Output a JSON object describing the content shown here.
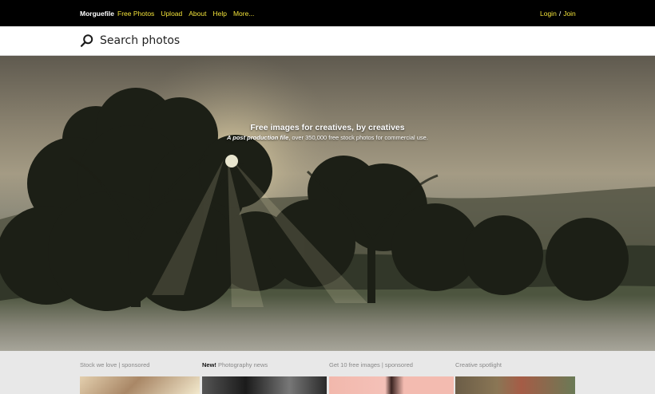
{
  "topbar": {
    "brand": "Morguefile",
    "nav": [
      "Free Photos",
      "Upload",
      "About",
      "Help",
      "More..."
    ],
    "login": "Login",
    "separator": "/",
    "join": "Join"
  },
  "search": {
    "placeholder": "Search photos",
    "icon": "search-icon"
  },
  "hero": {
    "title": "Free images for creatives, by creatives",
    "subtitle_emphasis": "A post production file",
    "subtitle_rest": ", over 350,000 free stock photos for commercial use."
  },
  "promos": {
    "stock": "Stock we love | sponsored",
    "news_new": "New!",
    "news_rest": " Photography news",
    "free": "Get 10 free images | sponsored",
    "spotlight": "Creative spotlight"
  },
  "colors": {
    "topbar_background": "#000000",
    "nav_link": "#f3e33a",
    "hero_overlay_text": "#ffffff"
  }
}
